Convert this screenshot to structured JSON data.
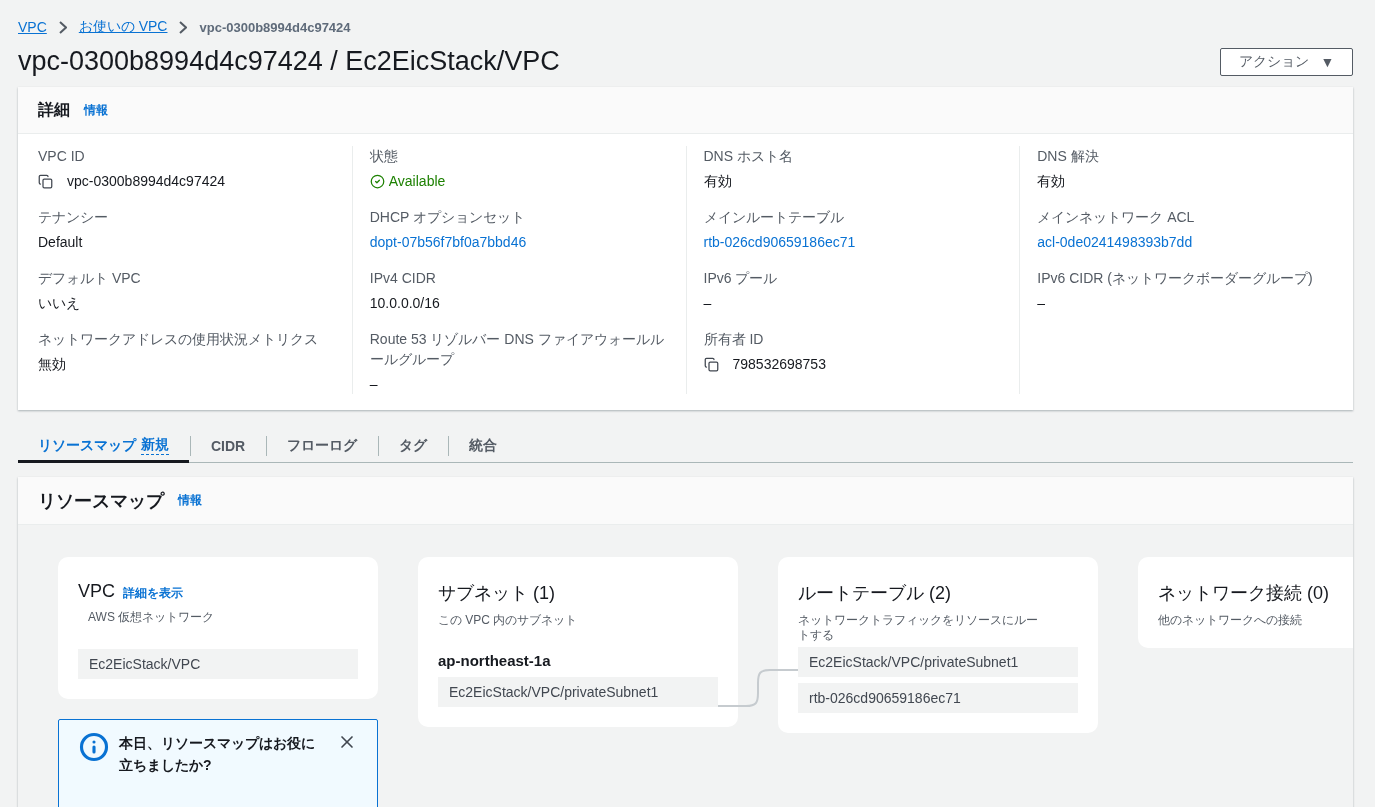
{
  "breadcrumbs": [
    {
      "label": "VPC",
      "kind": "link"
    },
    {
      "label": "お使いの VPC",
      "kind": "link"
    },
    {
      "label": "vpc-0300b8994d4c97424",
      "kind": "current"
    }
  ],
  "title": "vpc-0300b8994d4c97424 / Ec2EicStack/VPC",
  "actions_button": {
    "label": "アクション",
    "caret": "▼"
  },
  "details": {
    "title": "詳細",
    "info_link": "情報",
    "columns": [
      [
        {
          "label": "VPC ID",
          "value": "vpc-0300b8994d4c97424",
          "kind": "copy"
        },
        {
          "label": "テナンシー",
          "value": "Default",
          "kind": "text"
        },
        {
          "label": "デフォルト VPC",
          "value": "いいえ",
          "kind": "text"
        },
        {
          "label": "ネットワークアドレスの使用状況メトリクス",
          "value": "無効",
          "kind": "text"
        }
      ],
      [
        {
          "label": "状態",
          "value": "Available",
          "kind": "status"
        },
        {
          "label": "DHCP オプションセット",
          "value": "dopt-07b56f7bf0a7bbd46",
          "kind": "link"
        },
        {
          "label": "IPv4 CIDR",
          "value": "10.0.0.0/16",
          "kind": "text"
        },
        {
          "label": "Route 53 リゾルバー DNS ファイアウォールルールグループ",
          "value": "–",
          "kind": "text"
        }
      ],
      [
        {
          "label": "DNS ホスト名",
          "value": "有効",
          "kind": "text"
        },
        {
          "label": "メインルートテーブル",
          "value": "rtb-026cd90659186ec71",
          "kind": "link"
        },
        {
          "label": "IPv6 プール",
          "value": "–",
          "kind": "text"
        },
        {
          "label": "所有者 ID",
          "value": "798532698753",
          "kind": "copy"
        }
      ],
      [
        {
          "label": "DNS 解決",
          "value": "有効",
          "kind": "text"
        },
        {
          "label": "メインネットワーク ACL",
          "value": "acl-0de0241498393b7dd",
          "kind": "link"
        },
        {
          "label": "IPv6 CIDR (ネットワークボーダーグループ)",
          "value": "–",
          "kind": "text"
        }
      ]
    ]
  },
  "tabs": [
    {
      "label": "リソースマップ",
      "badge": "新規",
      "selected": true
    },
    {
      "label": "CIDR",
      "selected": false
    },
    {
      "label": "フローログ",
      "selected": false
    },
    {
      "label": "タグ",
      "selected": false
    },
    {
      "label": "統合",
      "selected": false
    }
  ],
  "resource_map": {
    "title": "リソースマップ",
    "info_link": "情報",
    "cards": [
      {
        "title": "VPC",
        "link": "詳細を表示",
        "subtitle": "AWS 仮想ネットワーク",
        "items": [
          "Ec2EicStack/VPC"
        ]
      },
      {
        "title": "サブネット (1)",
        "subtitle": "この VPC 内のサブネット",
        "zone": "ap-northeast-1a",
        "items": [
          "Ec2EicStack/VPC/privateSubnet1"
        ]
      },
      {
        "title": "ルートテーブル (2)",
        "subtitle": "ネットワークトラフィックをリソースにルートする",
        "items": [
          "Ec2EicStack/VPC/privateSubnet1",
          "rtb-026cd90659186ec71"
        ]
      },
      {
        "title": "ネットワーク接続 (0)",
        "subtitle": "他のネットワークへの接続"
      }
    ],
    "feedback": {
      "text": "本日、リソースマップはお役に立ちましたか?"
    }
  }
}
